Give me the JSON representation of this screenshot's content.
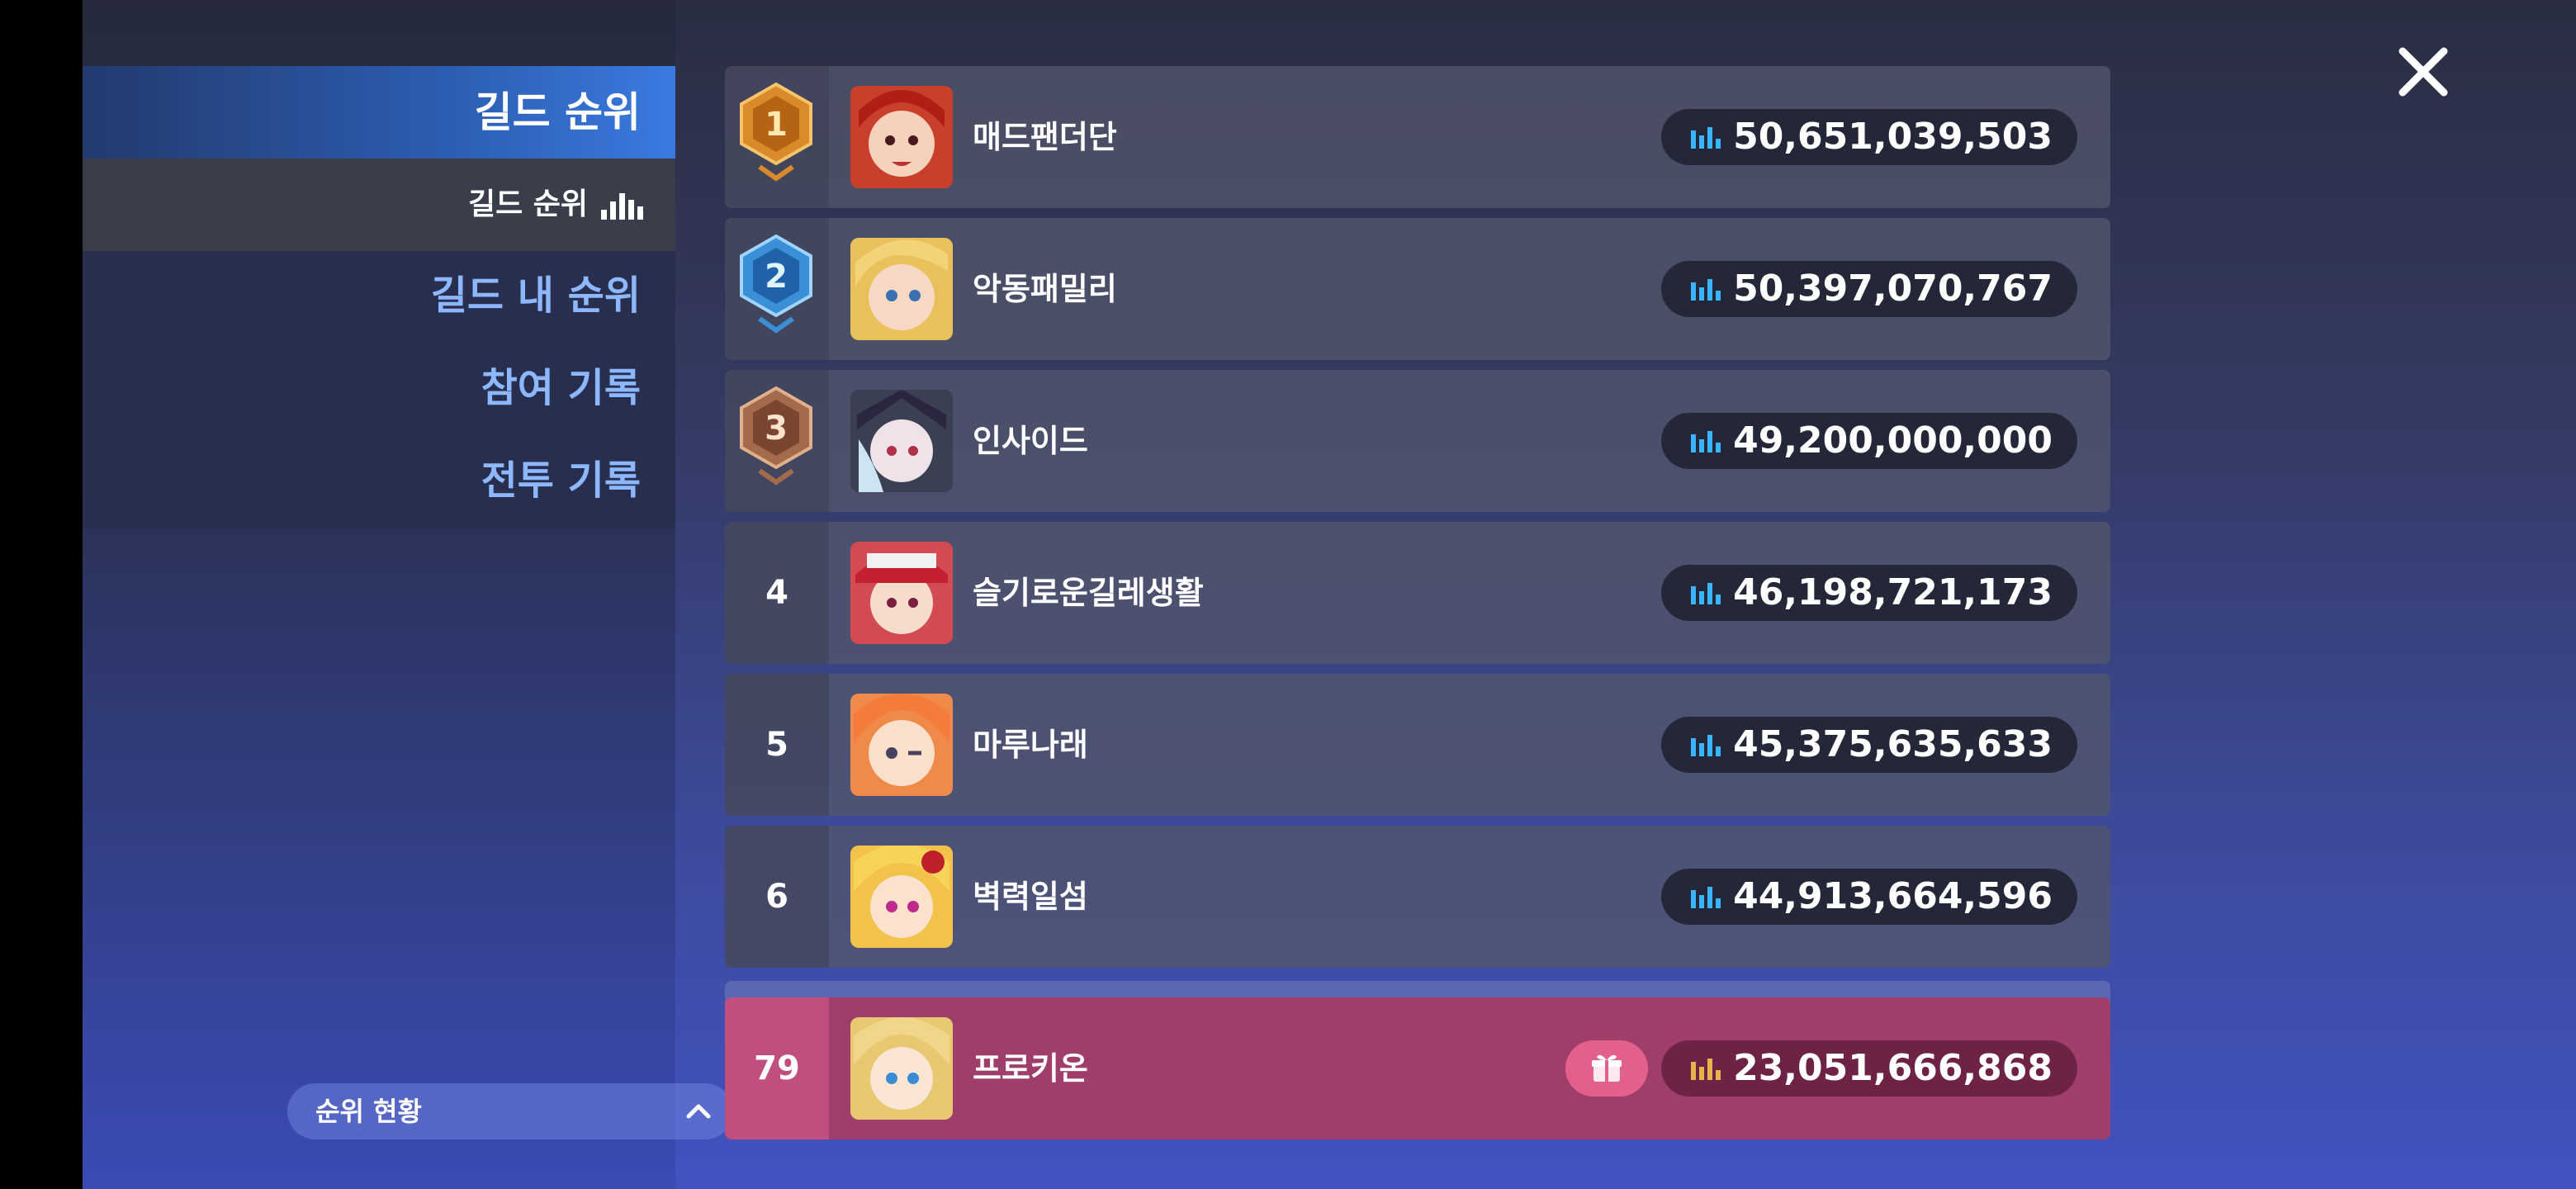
{
  "sidebar": {
    "active_label": "길드 순위",
    "submenu_label": "길드 순위",
    "items": [
      {
        "label": "길드 내 순위"
      },
      {
        "label": "참여 기록"
      },
      {
        "label": "전투 기록"
      }
    ],
    "status_pill_label": "순위 현황"
  },
  "colors": {
    "gold": "#d98a2b",
    "silver_blue": "#3a8fd6",
    "bronze": "#a46a4c",
    "highlight_row": "#a03e6b",
    "score_icon_blue": "#39b6ff",
    "score_icon_gold": "#e8b34a"
  },
  "rankings": [
    {
      "rank": "1",
      "medal": "gold-medal-icon",
      "name": "매드팬더단",
      "score": "50,651,039,503"
    },
    {
      "rank": "2",
      "medal": "blue-medal-icon",
      "name": "악동패밀리",
      "score": "50,397,070,767"
    },
    {
      "rank": "3",
      "medal": "bronze-medal-icon",
      "name": "인사이드",
      "score": "49,200,000,000"
    },
    {
      "rank": "4",
      "name": "슬기로운길레생활",
      "score": "46,198,721,173"
    },
    {
      "rank": "5",
      "name": "마루나래",
      "score": "45,375,635,633"
    },
    {
      "rank": "6",
      "name": "벽력일섬",
      "score": "44,913,664,596"
    }
  ],
  "my_guild": {
    "rank": "79",
    "name": "프로키온",
    "score": "23,051,666,868"
  },
  "icons": {
    "close": "close-icon",
    "score": "bar-chart-icon",
    "gift": "gift-icon",
    "chevron": "chevron-up-icon"
  }
}
